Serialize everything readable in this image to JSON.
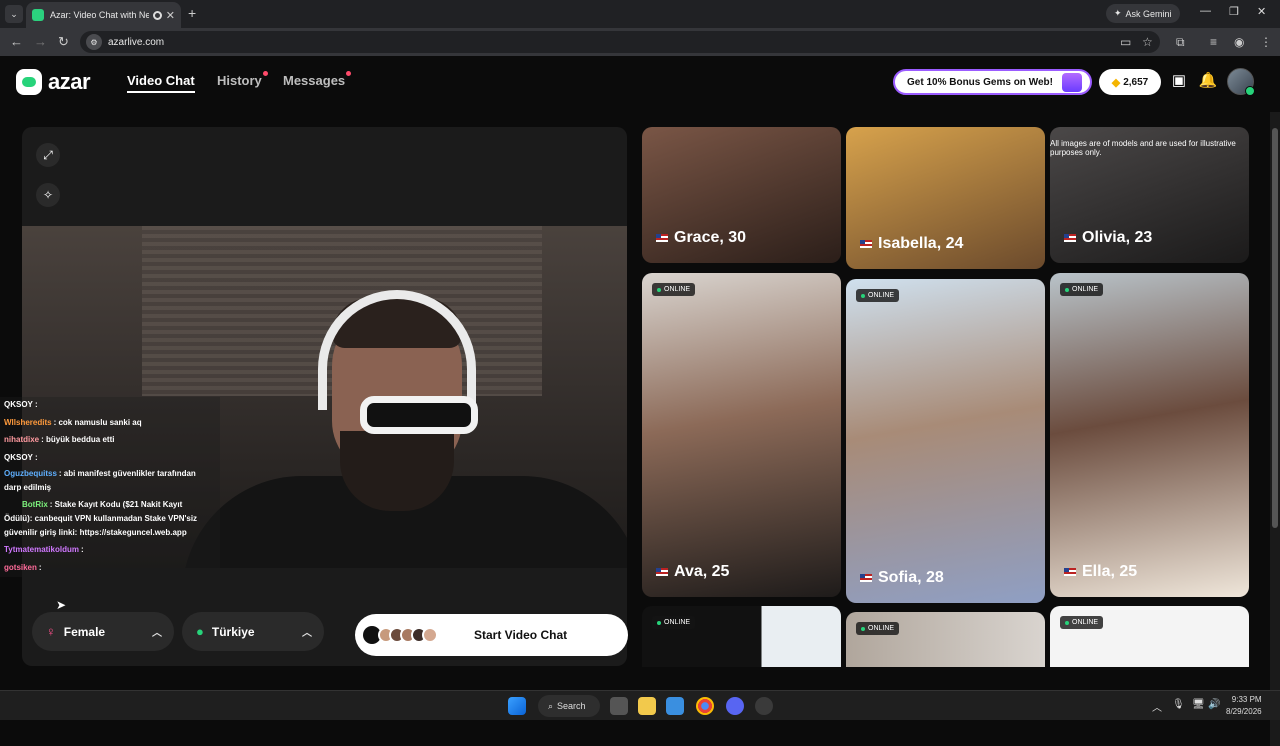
{
  "browser": {
    "tab_title": "Azar: Video Chat with New",
    "url": "azarlive.com",
    "ask_gemini": "Ask Gemini"
  },
  "header": {
    "logo": "azar",
    "nav": [
      {
        "label": "Video Chat"
      },
      {
        "label": "History"
      },
      {
        "label": "Messages"
      }
    ],
    "promo": "Get 10% Bonus Gems on Web!",
    "gems": "2,657"
  },
  "chat": [
    {
      "user": "QKSOY :",
      "msg": "",
      "color": "#ffffff"
    },
    {
      "user": "Wllsheredits",
      "msg": ": cok namuslu sanki aq",
      "color": "#ff9a3c"
    },
    {
      "user": "nihatdixe",
      "msg": ": büyük beddua etti",
      "color": "#ff7070"
    },
    {
      "user": "QKSOY :",
      "msg": "",
      "color": "#ffffff"
    },
    {
      "user": "Oguzbequitss",
      "msg": ": abi manifest güvenlikler tarafından",
      "color": "#5fb0ff"
    },
    {
      "user": "",
      "msg": "darp edilmiş",
      "color": "#ffffff"
    },
    {
      "user": "BotRix",
      "msg": ": Stake Kayıt Kodu ($21 Nakit Kayıt",
      "color": "#7cf27c"
    },
    {
      "user": "",
      "msg": "Ödülü): canbequit VPN kullanmadan Stake VPN'siz",
      "color": "#ffffff"
    },
    {
      "user": "",
      "msg": "güvenilir giriş linki: https://stakeguncel.web.app",
      "color": "#ffffff"
    },
    {
      "user": "Tytmatematikoldum",
      "msg": ":",
      "color": "#d078ff"
    },
    {
      "user": "gotsiken",
      "msg": ":",
      "color": "#ff6b9a"
    }
  ],
  "controls": {
    "gender": "Female",
    "country": "Türkiye",
    "start": "Start Video Chat"
  },
  "disclaimer": "All images are of models and are used for illustrative purposes only.",
  "online_label": "ONLINE",
  "cards": [
    {
      "name": "Grace, 30"
    },
    {
      "name": "Isabella, 24"
    },
    {
      "name": "Olivia, 23"
    },
    {
      "name": "Ava, 25"
    },
    {
      "name": "Sofia, 28"
    },
    {
      "name": "Ella, 25"
    }
  ],
  "taskbar": {
    "search": "Search",
    "time": "9:33 PM",
    "date": "8/29/2026"
  }
}
